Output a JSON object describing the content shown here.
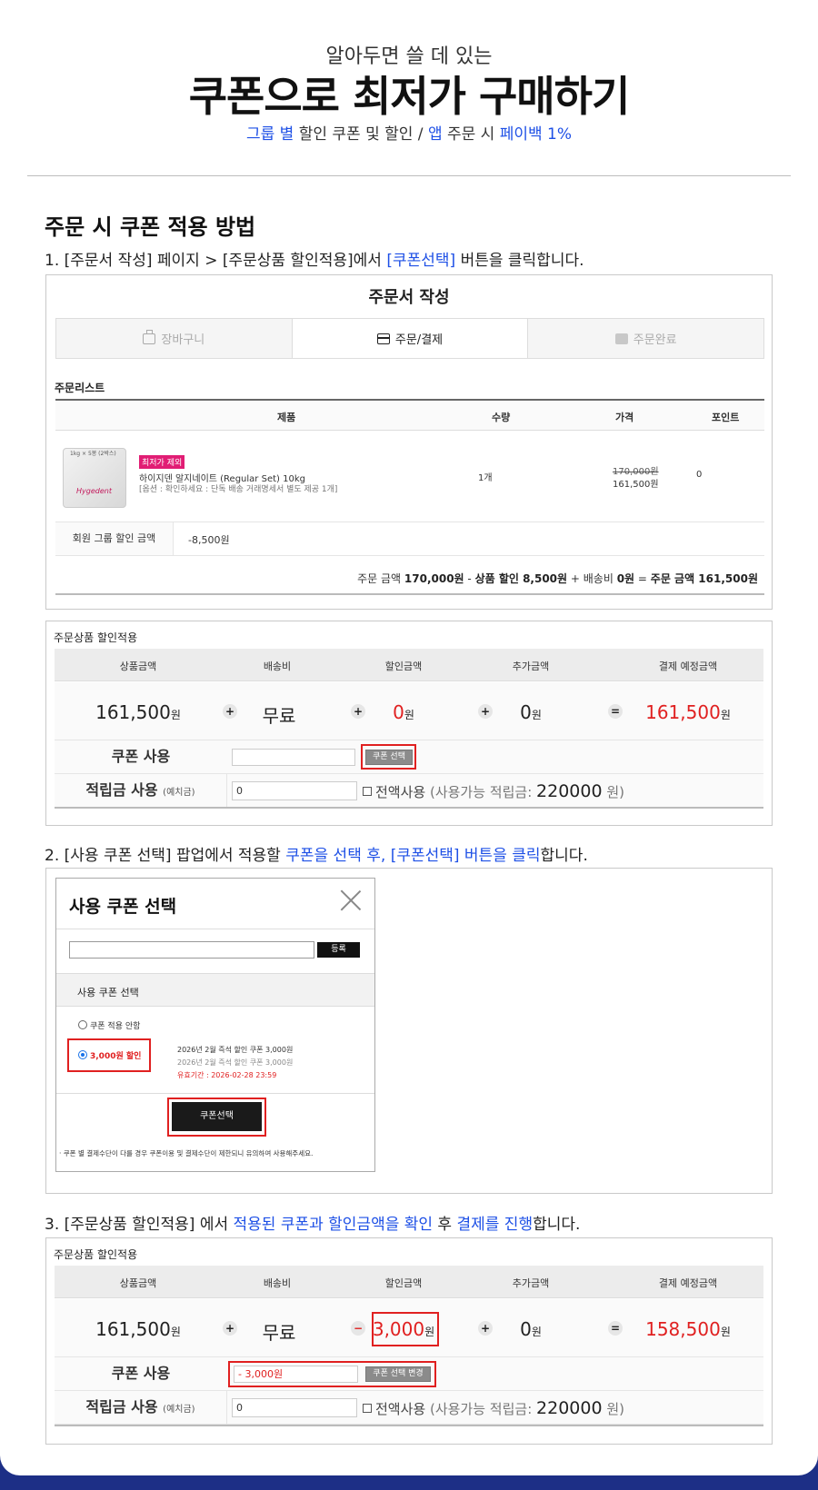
{
  "header": {
    "subtitle": "알아두면 쓸 데 있는",
    "title": "쿠폰으로 최저가 구매하기",
    "tagline": {
      "p1": "그룹 별",
      "p2": " 할인 쿠폰 및 할인 / ",
      "p3": "앱",
      "p4": " 주문 시 ",
      "p5": "페이백 1%"
    }
  },
  "section_title": "주문 시 쿠폰 적용 방법",
  "step1": {
    "p1": "1. [주문서 작성] 페이지 > [주문상품 할인적용]에서 ",
    "p2": "[쿠폰선택]",
    "p3": " 버튼을 클릭합니다."
  },
  "step2": {
    "p1": "2. [사용 쿠폰 선택] 팝업에서 적용할 ",
    "p2": "쿠폰을 선택 후, [쿠폰선택] 버튼을 클릭",
    "p3": "합니다."
  },
  "step3": {
    "p1": "3. [주문상품 할인적용] 에서 ",
    "p2": "적용된 쿠폰과 할인금액을 확인",
    "p3": " 후 ",
    "p4": "결제를 진행",
    "p5": "합니다."
  },
  "order": {
    "title": "주문서 작성",
    "steps": [
      "장바구니",
      "주문/결제",
      "주문완료"
    ],
    "list_label": "주문리스트",
    "columns": [
      "제품",
      "수량",
      "가격",
      "포인트"
    ],
    "item": {
      "thumb_note": "1kg × 5봉 (2박스)",
      "thumb_label": "Hygedent",
      "badge": "최저가 제외",
      "name": "하이지덴 알지네이트 (Regular Set) 10kg",
      "option": "[옵션 : 확인하세요 : 단독 배송 거래명세서 별도 제공 1개]",
      "qty": "1개",
      "price_old": "170,000원",
      "price_new": "161,500원",
      "point": "0"
    },
    "group_discount_label": "회원 그룹 할인 금액",
    "group_discount_value": "-8,500원",
    "summary": {
      "p1": "주문 금액 ",
      "p2": "170,000원",
      "p3": " - ",
      "p4": "상품 할인 8,500원",
      "p5": " + 배송비 ",
      "p6": "0원",
      "p7": " = ",
      "p8": "주문 금액",
      "p9": " 161,500원"
    }
  },
  "discount1": {
    "label": "주문상품 할인적용",
    "headers": [
      "상품금액",
      "배송비",
      "할인금액",
      "추가금액",
      "결제 예정금액"
    ],
    "values": {
      "product": "161,500",
      "shipping": "무료",
      "discount": "0",
      "extra": "0",
      "total": "161,500"
    },
    "unit": "원",
    "ops": [
      "+",
      "+",
      "+",
      "="
    ],
    "coupon_label": "쿠폰 사용",
    "coupon_input": "",
    "coupon_button": "쿠폰 선택",
    "points_label": "적립금 사용",
    "points_sub": "(예치금)",
    "points_input": "0",
    "use_all": "전액사용",
    "available_prefix": "(사용가능 적립금:",
    "available_value": "220000",
    "available_suffix": "원)"
  },
  "popup": {
    "title": "사용 쿠폰 선택",
    "register": "등록",
    "section": "사용 쿠폰 선택",
    "option_none": "쿠폰 적용 안함",
    "option_coupon": "3,000원 할인",
    "coupon_name": "2026년 2월 즉석 할인 쿠폰 3,000원",
    "coupon_name2": "2026년 2월 즉석 할인 쿠폰 3,000원",
    "validity": "유효기간 : 2026-02-28 23:59",
    "select_button": "쿠폰선택",
    "note": "· 쿠폰 별 결제수단이 다를 경우 쿠폰이용 및 결제수단이 제한되니 유의하여 사용해주세요."
  },
  "discount2": {
    "label": "주문상품 할인적용",
    "headers": [
      "상품금액",
      "배송비",
      "할인금액",
      "추가금액",
      "결제 예정금액"
    ],
    "values": {
      "product": "161,500",
      "shipping": "무료",
      "discount": "3,000",
      "extra": "0",
      "total": "158,500"
    },
    "unit": "원",
    "ops": [
      "+",
      "−",
      "+",
      "="
    ],
    "coupon_label": "쿠폰 사용",
    "coupon_input": "- 3,000원",
    "coupon_button": "쿠폰 선택 변경",
    "points_label": "적립금 사용",
    "points_sub": "(예치금)",
    "points_input": "0",
    "use_all": "전액사용",
    "available_prefix": "(사용가능 적립금:",
    "available_value": "220000",
    "available_suffix": "원)"
  },
  "colors": {
    "accent_blue": "#1e50e6",
    "accent_red": "#e02020",
    "footer_navy": "#1d2f86"
  }
}
